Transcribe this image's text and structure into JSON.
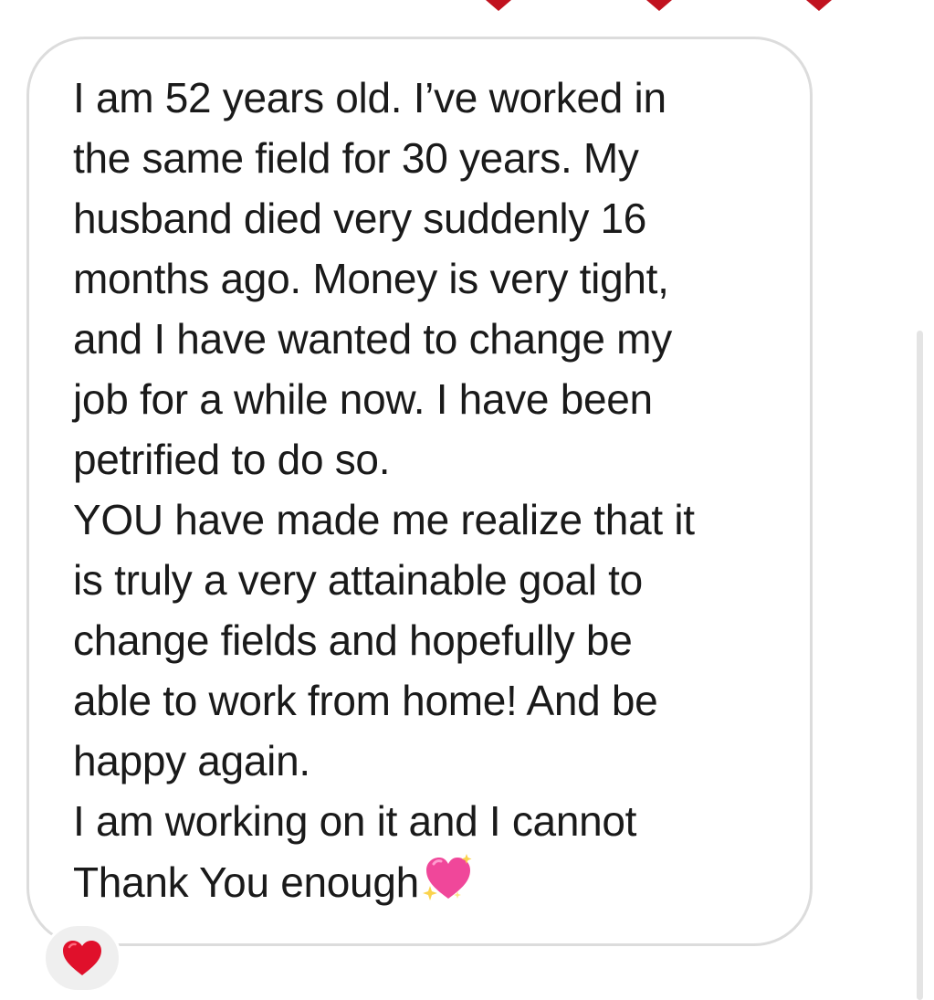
{
  "message": {
    "lines": [
      "I am 52 years old.  I’ve worked in",
      "the same field for 30 years.  My",
      "husband died very suddenly 16",
      "months ago.  Money is very tight,",
      "and I have wanted to change my",
      "job for a while now.  I have been",
      "petrified to do so.",
      "YOU have made me realize that it",
      "is truly a very attainable goal to",
      "change fields and hopefully be",
      "able to work from home!  And be",
      "happy again.",
      "I am working on it and I cannot",
      "Thank You enough"
    ],
    "trailing_emoji": "sparkling-heart-icon"
  },
  "reaction": {
    "emoji": "red-heart-icon"
  },
  "colors": {
    "text": "#1a1a1a",
    "bubble_border": "#dcdcdc",
    "heart_red": "#e0102b",
    "sparkle_heart_pink": "#f0479a",
    "reaction_bg": "#efefef",
    "scrollbar": "#e4e4e4",
    "top_heart": "#c1121f"
  }
}
